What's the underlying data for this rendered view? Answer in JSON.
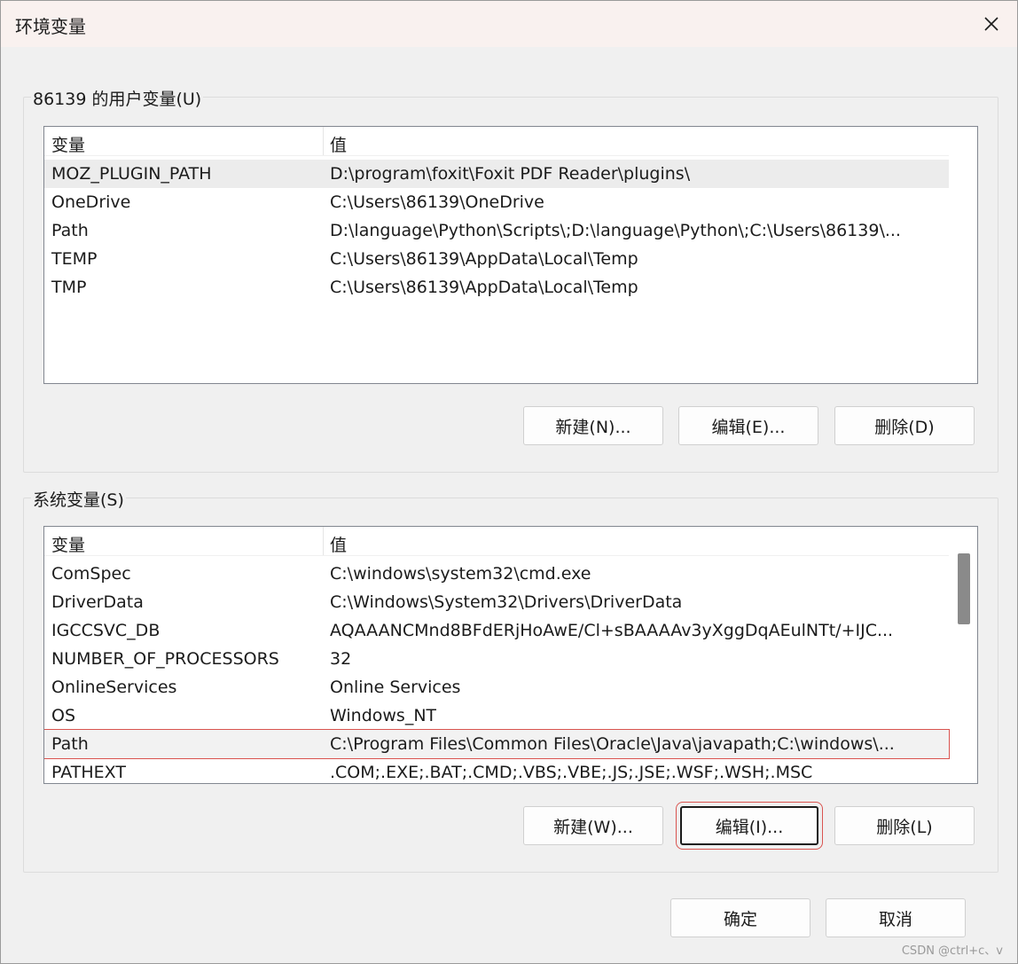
{
  "window": {
    "title": "环境变量"
  },
  "user_vars": {
    "group_label": "86139 的用户变量(U)",
    "col_name": "变量",
    "col_value": "值",
    "rows": [
      {
        "name": "MOZ_PLUGIN_PATH",
        "value": "D:\\program\\foxit\\Foxit PDF Reader\\plugins\\"
      },
      {
        "name": "OneDrive",
        "value": "C:\\Users\\86139\\OneDrive"
      },
      {
        "name": "Path",
        "value": "D:\\language\\Python\\Scripts\\;D:\\language\\Python\\;C:\\Users\\86139\\..."
      },
      {
        "name": "TEMP",
        "value": "C:\\Users\\86139\\AppData\\Local\\Temp"
      },
      {
        "name": "TMP",
        "value": "C:\\Users\\86139\\AppData\\Local\\Temp"
      }
    ],
    "new_label": "新建(N)...",
    "edit_label": "编辑(E)...",
    "delete_label": "删除(D)"
  },
  "system_vars": {
    "group_label": "系统变量(S)",
    "col_name": "变量",
    "col_value": "值",
    "rows": [
      {
        "name": "ComSpec",
        "value": "C:\\windows\\system32\\cmd.exe"
      },
      {
        "name": "DriverData",
        "value": "C:\\Windows\\System32\\Drivers\\DriverData"
      },
      {
        "name": "IGCCSVC_DB",
        "value": "AQAAANCMnd8BFdERjHoAwE/Cl+sBAAAAv3yXggDqAEulNTt/+IJC..."
      },
      {
        "name": "NUMBER_OF_PROCESSORS",
        "value": "32"
      },
      {
        "name": "OnlineServices",
        "value": "Online Services"
      },
      {
        "name": "OS",
        "value": "Windows_NT"
      },
      {
        "name": "Path",
        "value": "C:\\Program Files\\Common Files\\Oracle\\Java\\javapath;C:\\windows\\..."
      },
      {
        "name": "PATHEXT",
        "value": ".COM;.EXE;.BAT;.CMD;.VBS;.VBE;.JS;.JSE;.WSF;.WSH;.MSC"
      }
    ],
    "new_label": "新建(W)...",
    "edit_label": "编辑(I)...",
    "delete_label": "删除(L)"
  },
  "footer": {
    "ok_label": "确定",
    "cancel_label": "取消"
  },
  "watermark": "CSDN @ctrl+c、v"
}
